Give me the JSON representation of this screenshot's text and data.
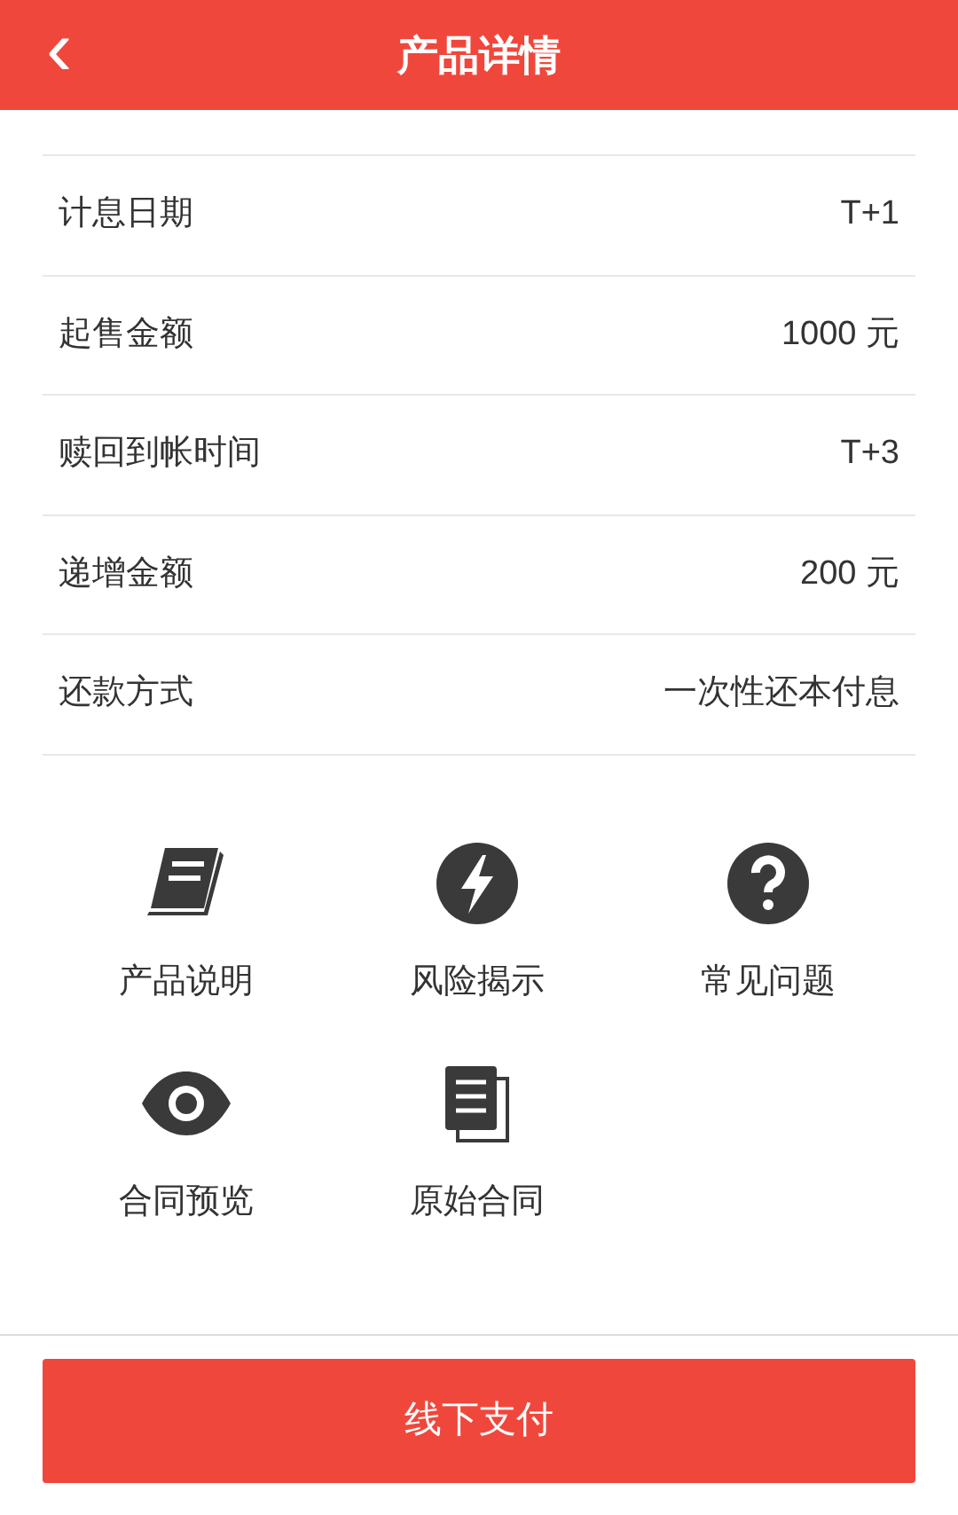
{
  "header": {
    "back": "‹",
    "title": "产品详情"
  },
  "rows": [
    {
      "label": "计息日期",
      "value": "T+1"
    },
    {
      "label": "起售金额",
      "value": "1000 元"
    },
    {
      "label": "赎回到帐时间",
      "value": "T+3"
    },
    {
      "label": "递增金额",
      "value": "200 元"
    },
    {
      "label": "还款方式",
      "value": "一次性还本付息"
    }
  ],
  "links": [
    {
      "kind": "book",
      "label": "产品说明"
    },
    {
      "kind": "bolt",
      "label": "风险揭示"
    },
    {
      "kind": "question",
      "label": "常见问题"
    },
    {
      "kind": "eye",
      "label": "合同预览"
    },
    {
      "kind": "document",
      "label": "原始合同"
    }
  ],
  "pay_button": "线下支付"
}
